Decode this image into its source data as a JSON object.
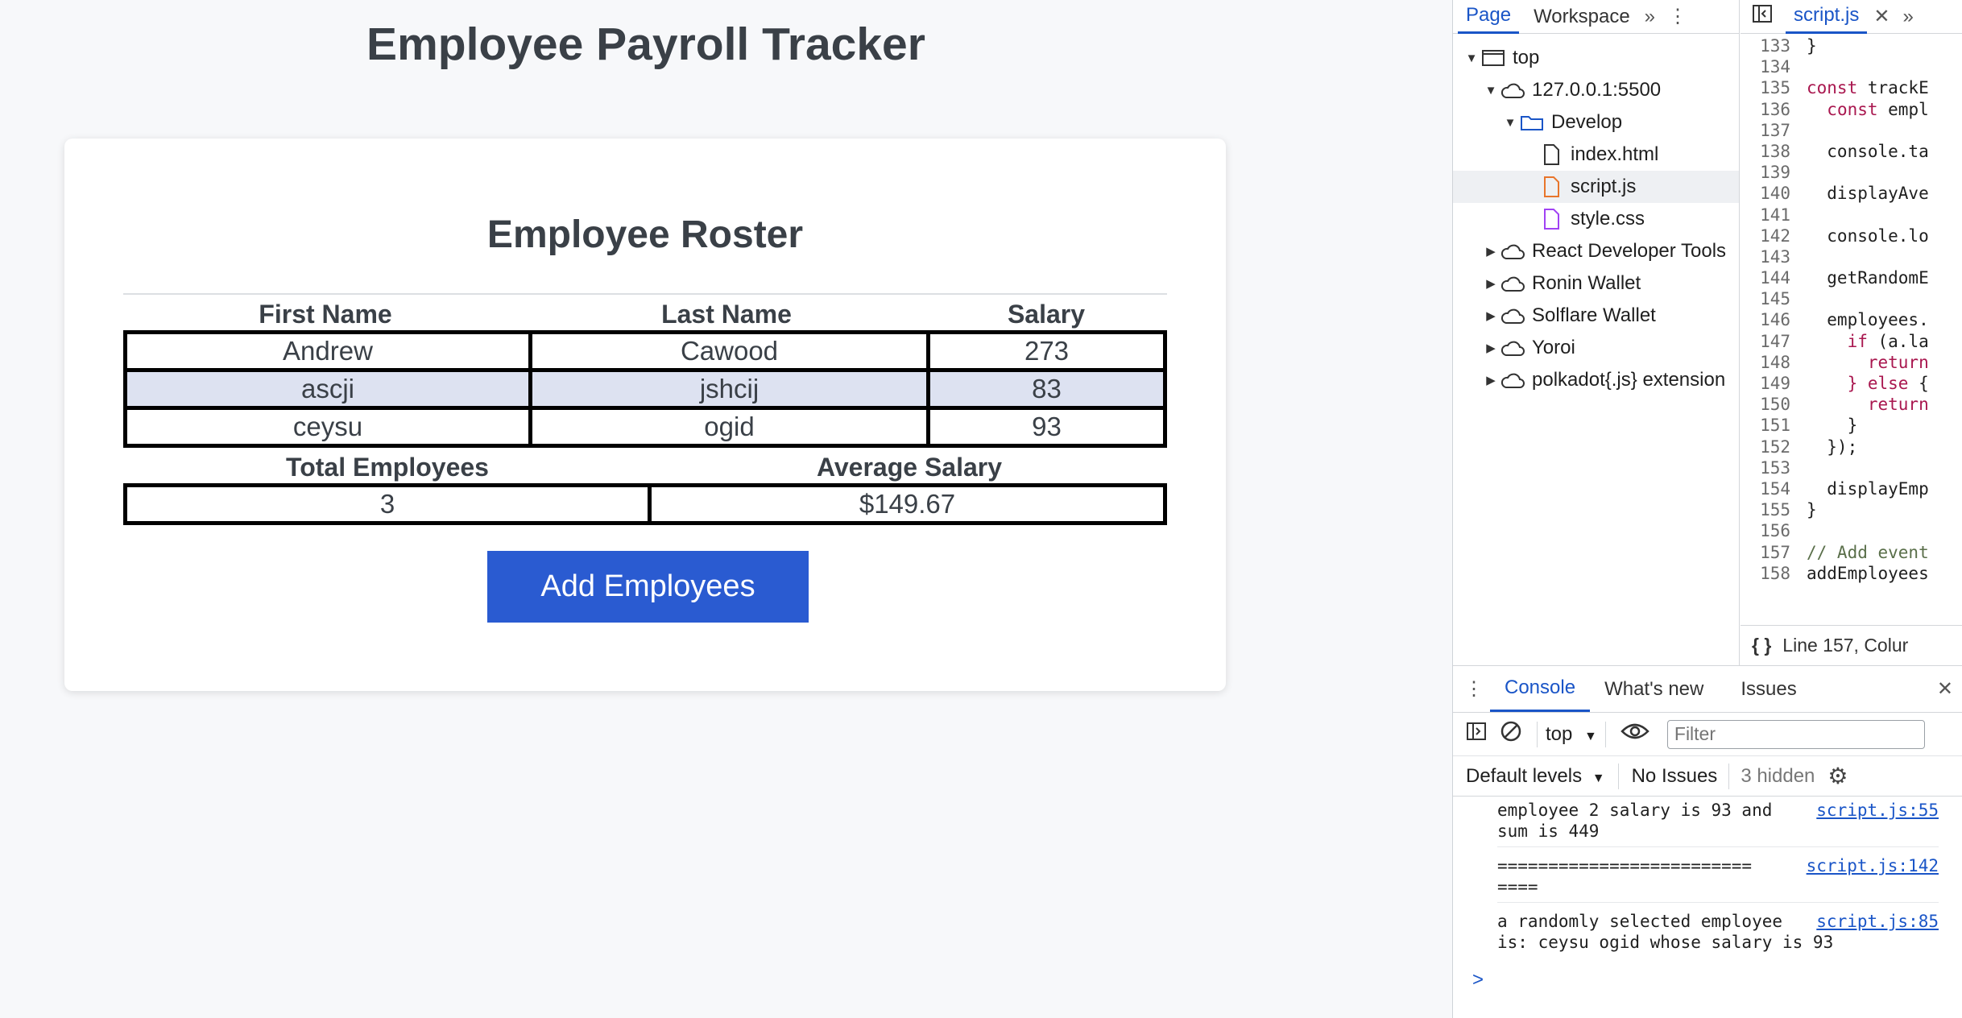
{
  "app": {
    "title": "Employee Payroll Tracker",
    "roster_title": "Employee Roster",
    "columns": [
      "First Name",
      "Last Name",
      "Salary"
    ],
    "employees": [
      {
        "first": "Andrew",
        "last": "Cawood",
        "salary": "273"
      },
      {
        "first": "ascji",
        "last": "jshcij",
        "salary": "83"
      },
      {
        "first": "ceysu",
        "last": "ogid",
        "salary": "93"
      }
    ],
    "summary_columns": [
      "Total Employees",
      "Average Salary"
    ],
    "summary": {
      "total": "3",
      "average": "$149.67"
    },
    "add_button": "Add Employees",
    "colors": {
      "button": "#2a5bd1",
      "alt_row": "#dde2f1"
    }
  },
  "devtools": {
    "nav_tabs": [
      "Page",
      "Workspace"
    ],
    "tree": {
      "top": "top",
      "host": "127.0.0.1:5500",
      "folder": "Develop",
      "files": [
        "index.html",
        "script.js",
        "style.css"
      ],
      "extensions": [
        "React Developer Tools",
        "Ronin Wallet",
        "Solflare Wallet",
        "Yoroi",
        "polkadot{.js} extension"
      ]
    },
    "editor_tab": "script.js",
    "code": [
      {
        "n": "133",
        "t": "}"
      },
      {
        "n": "134",
        "t": ""
      },
      {
        "n": "135",
        "t": "const trackE"
      },
      {
        "n": "136",
        "t": "  const empl"
      },
      {
        "n": "137",
        "t": ""
      },
      {
        "n": "138",
        "t": "  console.ta"
      },
      {
        "n": "139",
        "t": ""
      },
      {
        "n": "140",
        "t": "  displayAve"
      },
      {
        "n": "141",
        "t": ""
      },
      {
        "n": "142",
        "t": "  console.lo"
      },
      {
        "n": "143",
        "t": ""
      },
      {
        "n": "144",
        "t": "  getRandomE"
      },
      {
        "n": "145",
        "t": ""
      },
      {
        "n": "146",
        "t": "  employees."
      },
      {
        "n": "147",
        "t": "    if (a.la"
      },
      {
        "n": "148",
        "t": "      return"
      },
      {
        "n": "149",
        "t": "    } else {"
      },
      {
        "n": "150",
        "t": "      return"
      },
      {
        "n": "151",
        "t": "    }"
      },
      {
        "n": "152",
        "t": "  });"
      },
      {
        "n": "153",
        "t": ""
      },
      {
        "n": "154",
        "t": "  displayEmp"
      },
      {
        "n": "155",
        "t": "}"
      },
      {
        "n": "156",
        "t": ""
      },
      {
        "n": "157",
        "t": "// Add event"
      },
      {
        "n": "158",
        "t": "addEmployees"
      }
    ],
    "status": "Line 157, Colur",
    "drawer_tabs": [
      "Console",
      "What's new",
      "Issues"
    ],
    "context": "top",
    "filter_placeholder": "Filter",
    "levels": "Default levels",
    "no_issues": "No Issues",
    "hidden": "3 hidden",
    "messages": [
      {
        "text": "employee 2 salary is 93 and sum is 449",
        "source": "script.js:55"
      },
      {
        "text": "========================= ====",
        "source": "script.js:142"
      },
      {
        "text": "a randomly selected employee is: ceysu ogid whose salary is 93",
        "source": "script.js:85"
      }
    ],
    "prompt": ">"
  }
}
